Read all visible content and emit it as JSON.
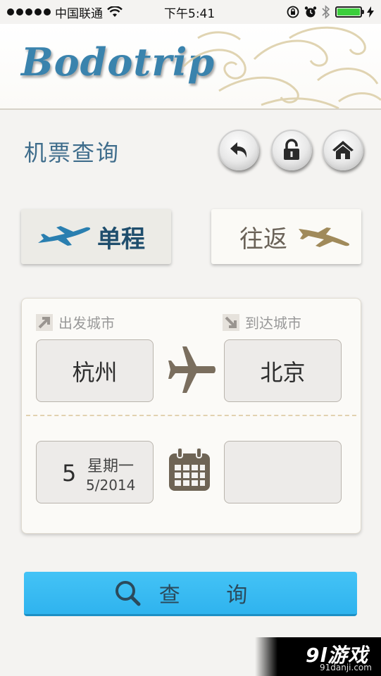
{
  "status_bar": {
    "carrier": "中国联通",
    "time": "下午5:41"
  },
  "header": {
    "logo_text": "Bodotrip"
  },
  "page": {
    "title": "机票查询"
  },
  "nav_buttons": {
    "back_icon": "back-arrow-icon",
    "lock_icon": "unlock-icon",
    "home_icon": "home-icon"
  },
  "trip_type": {
    "one_way_label": "单程",
    "round_trip_label": "往返",
    "selected": "单程"
  },
  "search_form": {
    "from_label": "出发城市",
    "to_label": "到达城市",
    "from_city": "杭州",
    "to_city": "北京",
    "depart_day": "5",
    "depart_weekday": "星期一",
    "depart_month_year": "5/2014",
    "return_date": ""
  },
  "search_button": {
    "label": "查 询"
  },
  "watermark": {
    "brand": "9l游戏",
    "url": "91danji.com"
  },
  "colors": {
    "accent_blue": "#3a83ad",
    "search_button": "#3bbdf3",
    "page_background": "#f4f3f1",
    "plane_blue": "#2a7fb0",
    "plane_tan": "#a08a5a"
  }
}
